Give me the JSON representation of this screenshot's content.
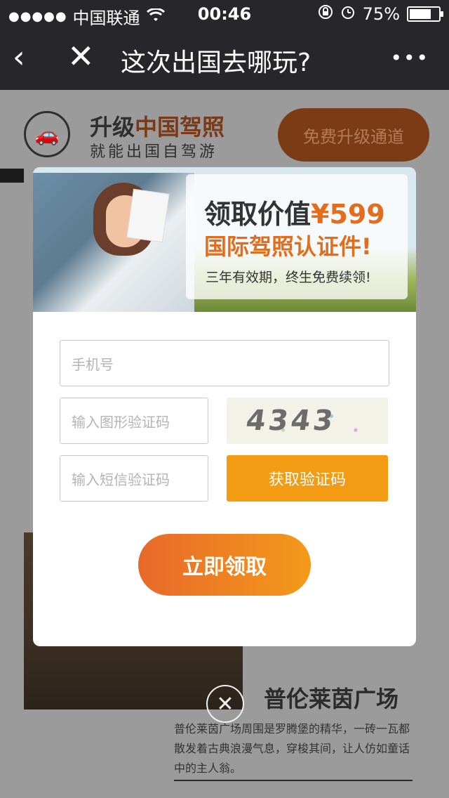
{
  "status_bar": {
    "signal_dots": "●●●●●",
    "carrier": "中国联通",
    "wifi_icon": "wifi-icon",
    "time": "00:46",
    "battery_percent_text": "75%",
    "battery_level": 0.75
  },
  "nav": {
    "title": "这次出国去哪玩?",
    "back_icon": "chevron-left-icon",
    "close_icon": "close-icon",
    "more_icon": "more-icon"
  },
  "background_page": {
    "upgrade_title_part1": "升级",
    "upgrade_title_part2": "中国驾照",
    "upgrade_subtitle": "就能出国自驾游",
    "free_upgrade_button": "免费升级通道",
    "plaza_title": "普伦莱茵广场",
    "plaza_text": "普伦莱茵广场周围是罗腾堡的精华，一砖一瓦都散发着古典浪漫气息，穿梭其间，让人仿如童话中的主人翁。"
  },
  "modal": {
    "banner": {
      "headline_prefix": "领取价值",
      "headline_price": "¥599",
      "headline_line2": "国际驾照认证件!",
      "subline": "三年有效期，终生免费续领!"
    },
    "phone_placeholder": "手机号",
    "captcha_placeholder": "输入图形验证码",
    "sms_placeholder": "输入短信验证码",
    "captcha_code": "4343",
    "get_code_button": "获取验证码",
    "claim_button": "立即领取"
  }
}
